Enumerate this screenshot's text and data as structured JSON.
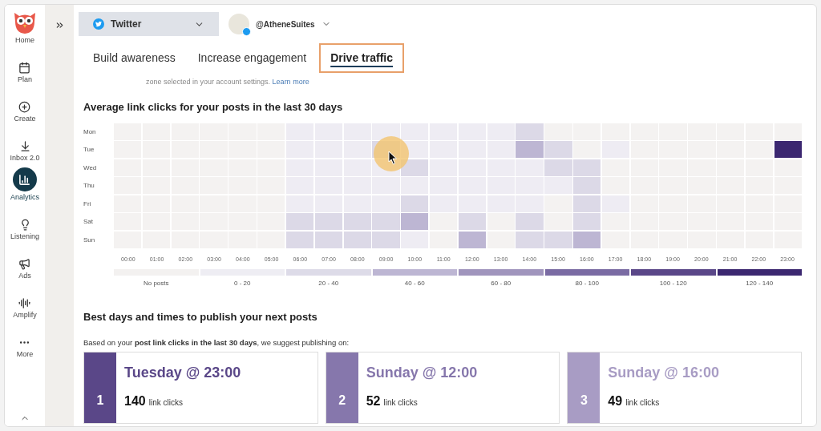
{
  "sidebar": {
    "items": [
      {
        "label": "Home",
        "kind": "logo",
        "selected": false
      },
      {
        "label": "Plan",
        "kind": "plan",
        "selected": false
      },
      {
        "label": "Create",
        "kind": "create",
        "selected": false
      },
      {
        "label": "Inbox 2.0",
        "kind": "inbox",
        "selected": false
      },
      {
        "label": "Analytics",
        "kind": "analytics",
        "selected": true
      },
      {
        "label": "Listening",
        "kind": "listening",
        "selected": false
      },
      {
        "label": "Ads",
        "kind": "ads",
        "selected": false
      },
      {
        "label": "Amplify",
        "kind": "amplify",
        "selected": false
      },
      {
        "label": "More",
        "kind": "more",
        "selected": false
      }
    ]
  },
  "network_select": {
    "value": "Twitter"
  },
  "account_select": {
    "value": "@AtheneSuites"
  },
  "tabs": [
    {
      "label": "Build awareness",
      "selected": false
    },
    {
      "label": "Increase engagement",
      "selected": false
    },
    {
      "label": "Drive traffic",
      "selected": true
    }
  ],
  "notice": {
    "text": "zone selected in your account settings.",
    "link": "Learn more"
  },
  "heatmap": {
    "title": "Average link clicks for your posts in the last 30 days",
    "hours": [
      "00:00",
      "01:00",
      "02:00",
      "03:00",
      "04:00",
      "05:00",
      "06:00",
      "07:00",
      "08:00",
      "09:00",
      "10:00",
      "11:00",
      "12:00",
      "13:00",
      "14:00",
      "15:00",
      "16:00",
      "17:00",
      "18:00",
      "19:00",
      "20:00",
      "21:00",
      "22:00",
      "23:00"
    ],
    "rows": [
      {
        "day": "Mon",
        "cells": [
          {
            "color": "#f4f2f1"
          },
          {
            "color": "#f4f2f1"
          },
          {
            "color": "#f4f2f1"
          },
          {
            "color": "#f4f2f1"
          },
          {
            "color": "#f4f2f1"
          },
          {
            "color": "#f4f2f1"
          },
          {
            "color": "#eeecf3"
          },
          {
            "color": "#eeecf3"
          },
          {
            "color": "#eeecf3"
          },
          {
            "color": "#eeecf3"
          },
          {
            "color": "#eeecf3"
          },
          {
            "color": "#eeecf3"
          },
          {
            "color": "#eeecf3"
          },
          {
            "color": "#eeecf3"
          },
          {
            "color": "#dcd9e7"
          },
          {
            "color": "#f4f2f1"
          },
          {
            "color": "#f4f2f1"
          },
          {
            "color": "#f4f2f1"
          },
          {
            "color": "#f4f2f1"
          },
          {
            "color": "#f4f2f1"
          },
          {
            "color": "#f4f2f1"
          },
          {
            "color": "#f4f2f1"
          },
          {
            "color": "#f4f2f1"
          },
          {
            "color": "#f4f2f1"
          }
        ]
      },
      {
        "day": "Tue",
        "cells": [
          {
            "color": "#f4f2f1"
          },
          {
            "color": "#f4f2f1"
          },
          {
            "color": "#f4f2f1"
          },
          {
            "color": "#f4f2f1"
          },
          {
            "color": "#f4f2f1"
          },
          {
            "color": "#f4f2f1"
          },
          {
            "color": "#eeecf3"
          },
          {
            "color": "#eeecf3"
          },
          {
            "color": "#eeecf3"
          },
          {
            "color": "#dcd9e7"
          },
          {
            "color": "#eeecf3"
          },
          {
            "color": "#eeecf3"
          },
          {
            "color": "#eeecf3"
          },
          {
            "color": "#eeecf3"
          },
          {
            "color": "#bdb6d3"
          },
          {
            "color": "#dcd9e7"
          },
          {
            "color": "#f4f2f1"
          },
          {
            "color": "#eeecf3"
          },
          {
            "color": "#f4f2f1"
          },
          {
            "color": "#f4f2f1"
          },
          {
            "color": "#f4f2f1"
          },
          {
            "color": "#f4f2f1"
          },
          {
            "color": "#f4f2f1"
          },
          {
            "color": "#3b2770"
          }
        ]
      },
      {
        "day": "Wed",
        "cells": [
          {
            "color": "#f4f2f1"
          },
          {
            "color": "#f4f2f1"
          },
          {
            "color": "#f4f2f1"
          },
          {
            "color": "#f4f2f1"
          },
          {
            "color": "#f4f2f1"
          },
          {
            "color": "#f4f2f1"
          },
          {
            "color": "#eeecf3"
          },
          {
            "color": "#eeecf3"
          },
          {
            "color": "#eeecf3"
          },
          {
            "color": "#eeecf3"
          },
          {
            "color": "#dcd9e7"
          },
          {
            "color": "#eeecf3"
          },
          {
            "color": "#eeecf3"
          },
          {
            "color": "#eeecf3"
          },
          {
            "color": "#eeecf3"
          },
          {
            "color": "#dcd9e7"
          },
          {
            "color": "#dcd9e7"
          },
          {
            "color": "#f4f2f1"
          },
          {
            "color": "#f4f2f1"
          },
          {
            "color": "#f4f2f1"
          },
          {
            "color": "#f4f2f1"
          },
          {
            "color": "#f4f2f1"
          },
          {
            "color": "#f4f2f1"
          },
          {
            "color": "#f4f2f1"
          }
        ]
      },
      {
        "day": "Thu",
        "cells": [
          {
            "color": "#f4f2f1"
          },
          {
            "color": "#f4f2f1"
          },
          {
            "color": "#f4f2f1"
          },
          {
            "color": "#f4f2f1"
          },
          {
            "color": "#f4f2f1"
          },
          {
            "color": "#f4f2f1"
          },
          {
            "color": "#eeecf3"
          },
          {
            "color": "#eeecf3"
          },
          {
            "color": "#eeecf3"
          },
          {
            "color": "#eeecf3"
          },
          {
            "color": "#eeecf3"
          },
          {
            "color": "#eeecf3"
          },
          {
            "color": "#eeecf3"
          },
          {
            "color": "#eeecf3"
          },
          {
            "color": "#eeecf3"
          },
          {
            "color": "#eeecf3"
          },
          {
            "color": "#dcd9e7"
          },
          {
            "color": "#f4f2f1"
          },
          {
            "color": "#f4f2f1"
          },
          {
            "color": "#f4f2f1"
          },
          {
            "color": "#f4f2f1"
          },
          {
            "color": "#f4f2f1"
          },
          {
            "color": "#f4f2f1"
          },
          {
            "color": "#f4f2f1"
          }
        ]
      },
      {
        "day": "Fri",
        "cells": [
          {
            "color": "#f4f2f1"
          },
          {
            "color": "#f4f2f1"
          },
          {
            "color": "#f4f2f1"
          },
          {
            "color": "#f4f2f1"
          },
          {
            "color": "#f4f2f1"
          },
          {
            "color": "#f4f2f1"
          },
          {
            "color": "#eeecf3"
          },
          {
            "color": "#eeecf3"
          },
          {
            "color": "#eeecf3"
          },
          {
            "color": "#eeecf3"
          },
          {
            "color": "#dcd9e7"
          },
          {
            "color": "#eeecf3"
          },
          {
            "color": "#eeecf3"
          },
          {
            "color": "#eeecf3"
          },
          {
            "color": "#eeecf3"
          },
          {
            "color": "#f4f2f1"
          },
          {
            "color": "#dcd9e7"
          },
          {
            "color": "#eeecf3"
          },
          {
            "color": "#f4f2f1"
          },
          {
            "color": "#f4f2f1"
          },
          {
            "color": "#f4f2f1"
          },
          {
            "color": "#f4f2f1"
          },
          {
            "color": "#f4f2f1"
          },
          {
            "color": "#f4f2f1"
          }
        ]
      },
      {
        "day": "Sat",
        "cells": [
          {
            "color": "#f4f2f1"
          },
          {
            "color": "#f4f2f1"
          },
          {
            "color": "#f4f2f1"
          },
          {
            "color": "#f4f2f1"
          },
          {
            "color": "#f4f2f1"
          },
          {
            "color": "#f4f2f1"
          },
          {
            "color": "#dcd9e7"
          },
          {
            "color": "#dcd9e7"
          },
          {
            "color": "#dcd9e7"
          },
          {
            "color": "#dcd9e7"
          },
          {
            "color": "#bdb6d3"
          },
          {
            "color": "#f4f2f1"
          },
          {
            "color": "#dcd9e7"
          },
          {
            "color": "#f4f2f1"
          },
          {
            "color": "#dcd9e7"
          },
          {
            "color": "#f4f2f1"
          },
          {
            "color": "#dcd9e7"
          },
          {
            "color": "#f4f2f1"
          },
          {
            "color": "#f4f2f1"
          },
          {
            "color": "#f4f2f1"
          },
          {
            "color": "#f4f2f1"
          },
          {
            "color": "#f4f2f1"
          },
          {
            "color": "#f4f2f1"
          },
          {
            "color": "#f4f2f1"
          }
        ]
      },
      {
        "day": "Sun",
        "cells": [
          {
            "color": "#f4f2f1"
          },
          {
            "color": "#f4f2f1"
          },
          {
            "color": "#f4f2f1"
          },
          {
            "color": "#f4f2f1"
          },
          {
            "color": "#f4f2f1"
          },
          {
            "color": "#f4f2f1"
          },
          {
            "color": "#dcd9e7"
          },
          {
            "color": "#dcd9e7"
          },
          {
            "color": "#dcd9e7"
          },
          {
            "color": "#dcd9e7"
          },
          {
            "color": "#eeecf3"
          },
          {
            "color": "#f4f2f1"
          },
          {
            "color": "#bdb6d3"
          },
          {
            "color": "#f4f2f1"
          },
          {
            "color": "#dcd9e7"
          },
          {
            "color": "#dcd9e7"
          },
          {
            "color": "#bdb6d3"
          },
          {
            "color": "#f4f2f1"
          },
          {
            "color": "#f4f2f1"
          },
          {
            "color": "#f4f2f1"
          },
          {
            "color": "#f4f2f1"
          },
          {
            "color": "#f4f2f1"
          },
          {
            "color": "#f4f2f1"
          },
          {
            "color": "#f4f2f1"
          }
        ]
      }
    ],
    "legend": [
      {
        "label": "No posts",
        "color": "#f3f1f0"
      },
      {
        "label": "0 - 20",
        "color": "#eeedf3"
      },
      {
        "label": "20 - 40",
        "color": "#dddbe8"
      },
      {
        "label": "40 - 60",
        "color": "#bdb6d3"
      },
      {
        "label": "60 - 80",
        "color": "#a095bd"
      },
      {
        "label": "80 - 100",
        "color": "#7a6ba3"
      },
      {
        "label": "100 - 120",
        "color": "#5a4788"
      },
      {
        "label": "120 - 140",
        "color": "#3b2770"
      }
    ]
  },
  "best_times": {
    "title": "Best days and times to publish your next posts",
    "intro": "Based on your **post link clicks in the last 30 days**, we suggest publishing on:",
    "cards": [
      {
        "rank": "1",
        "when": "Tuesday @ 23:00",
        "count": "140",
        "unit": "link clicks",
        "color": "#5a4788"
      },
      {
        "rank": "2",
        "when": "Sunday @ 12:00",
        "count": "52",
        "unit": "link clicks",
        "color": "#8677ac"
      },
      {
        "rank": "3",
        "when": "Sunday @ 16:00",
        "count": "49",
        "unit": "link clicks",
        "color": "#a89cc4"
      }
    ]
  }
}
